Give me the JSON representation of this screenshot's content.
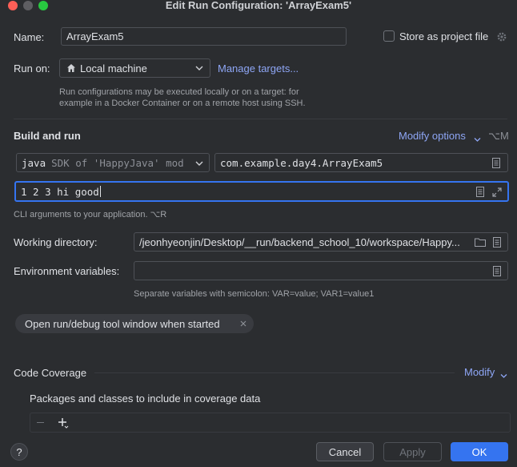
{
  "window": {
    "title": "Edit Run Configuration: 'ArrayExam5'"
  },
  "name": {
    "label": "Name:",
    "value": "ArrayExam5"
  },
  "store_as_project": {
    "label": "Store as project file",
    "checked": false
  },
  "run_on": {
    "label": "Run on:",
    "value": "Local machine",
    "manage_link": "Manage targets...",
    "help_line1": "Run configurations may be executed locally or on a target: for",
    "help_line2": "example in a Docker Container or on a remote host using SSH."
  },
  "build_run": {
    "title": "Build and run",
    "modify_options": "Modify options",
    "modify_shortcut": "⌥M",
    "java_keyword": "java",
    "sdk_text": "SDK of 'HappyJava' mod",
    "main_class": "com.example.day4.ArrayExam5",
    "program_args": "1 2 3 hi good",
    "args_hint": "CLI arguments to your application. ⌥R"
  },
  "working_dir": {
    "label": "Working directory:",
    "value": "/jeonhyeonjin/Desktop/__run/backend_school_10/workspace/Happy..."
  },
  "env_vars": {
    "label": "Environment variables:",
    "value": "",
    "hint": "Separate variables with semicolon: VAR=value; VAR1=value1"
  },
  "open_tool_window": {
    "label": "Open run/debug tool window when started"
  },
  "code_coverage": {
    "title": "Code Coverage",
    "modify": "Modify",
    "packages_label": "Packages and classes to include in coverage data"
  },
  "buttons": {
    "help": "?",
    "cancel": "Cancel",
    "apply": "Apply",
    "ok": "OK"
  },
  "colors": {
    "background": "#2b2d30",
    "accent": "#3574f0",
    "link": "#8ea6f5"
  }
}
